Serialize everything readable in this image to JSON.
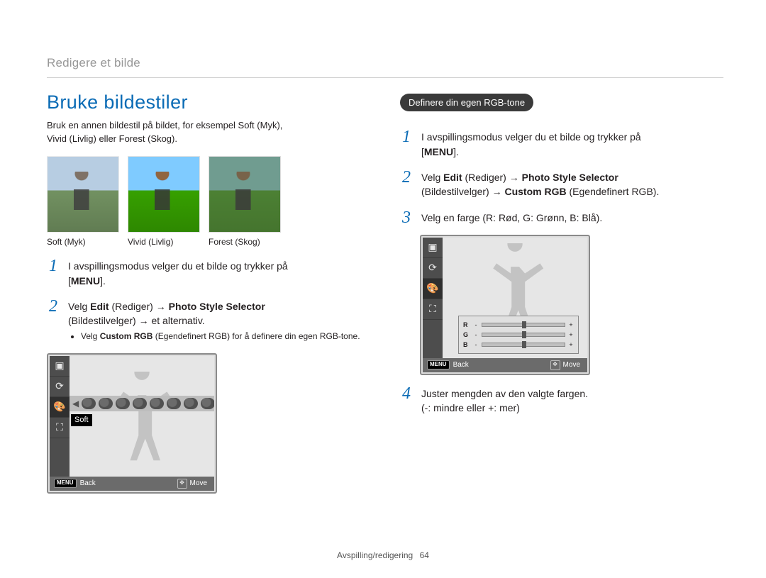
{
  "breadcrumb": "Redigere et bilde",
  "heading": "Bruke bildestiler",
  "intro_line1": "Bruk en annen bildestil på bildet, for eksempel Soft (Myk),",
  "intro_line2": "Vivid (Livlig) eller Forest (Skog).",
  "thumbs": [
    {
      "caption": "Soft (Myk)"
    },
    {
      "caption": "Vivid (Livlig)"
    },
    {
      "caption": "Forest (Skog)"
    }
  ],
  "left_steps": {
    "s1": {
      "num": "1",
      "text": "I avspillingsmodus velger du et bilde og trykker på",
      "menu": "MENU",
      "tail": "."
    },
    "s2": {
      "num": "2",
      "prefix": "Velg ",
      "b1": "Edit",
      "mid1": " (Rediger) → ",
      "b2": "Photo Style Selector",
      "line2": "(Bildestilvelger) → et alternativ."
    },
    "s2_bullet": "Velg Custom RGB (Egendefinert RGB) for å definere din egen RGB-tone.",
    "s2_bullet_b": "Custom RGB"
  },
  "left_lcd": {
    "soft_label": "Soft",
    "back": "Back",
    "move": "Move",
    "menu": "MENU"
  },
  "right": {
    "pill": "Definere din egen RGB-tone",
    "s1": {
      "num": "1",
      "text": "I avspillingsmodus velger du et bilde og trykker på",
      "menu": "MENU",
      "tail": "."
    },
    "s2": {
      "num": "2",
      "prefix": "Velg ",
      "b1": "Edit",
      "mid1": " (Rediger) → ",
      "b2": "Photo Style Selector",
      "line2_a": "(Bildestilvelger) → ",
      "b3": "Custom RGB",
      "line2_b": " (Egendefinert RGB)."
    },
    "s3": {
      "num": "3",
      "text": "Velg en farge (R: Rød, G: Grønn, B: Blå)."
    },
    "s4": {
      "num": "4",
      "line1": "Juster mengden av den valgte fargen.",
      "line2": "(-: mindre eller +: mer)"
    }
  },
  "right_lcd": {
    "r": "R",
    "g": "G",
    "b": "B",
    "minus": "-",
    "plus": "+",
    "back": "Back",
    "move": "Move",
    "menu": "MENU"
  },
  "footer": {
    "section": "Avspilling/redigering",
    "page": "64"
  }
}
